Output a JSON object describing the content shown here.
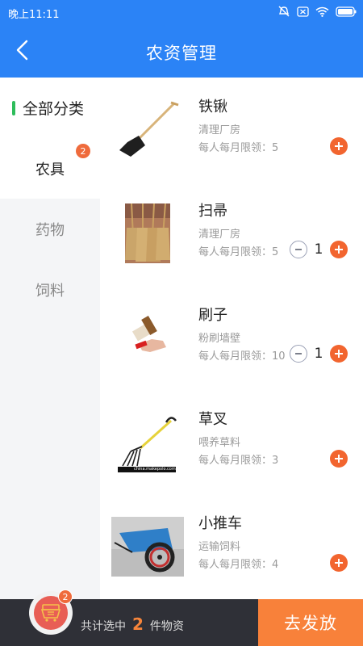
{
  "status_bar": {
    "time": "晚上11:11"
  },
  "header": {
    "title": "农资管理"
  },
  "sidebar": {
    "items": [
      {
        "label": "全部分类"
      },
      {
        "label": "农具",
        "badge": "2"
      },
      {
        "label": "药物"
      },
      {
        "label": "饲料"
      }
    ]
  },
  "products": [
    {
      "name": "铁锹",
      "desc": "清理厂房",
      "limit": "每人每月限领：5",
      "qty": ""
    },
    {
      "name": "扫帚",
      "desc": "清理厂房",
      "limit": "每人每月限领：5",
      "qty": "1"
    },
    {
      "name": "刷子",
      "desc": "粉刷墙壁",
      "limit": "每人每月限领：10",
      "qty": "1"
    },
    {
      "name": "草叉",
      "desc": "喂养草料",
      "limit": "每人每月限领：3",
      "qty": "",
      "image_caption": "china.makepolo.com"
    },
    {
      "name": "小推车",
      "desc": "运输饲料",
      "limit": "每人每月限领：4",
      "qty": ""
    }
  ],
  "footer": {
    "cart_badge": "2",
    "total_prefix": "共计选中",
    "total_count": "2",
    "total_suffix": "件物资",
    "dispatch_label": "去发放"
  },
  "colors": {
    "primary": "#2b83f6",
    "accent": "#f2652f",
    "active_indicator": "#2ebd5b"
  }
}
